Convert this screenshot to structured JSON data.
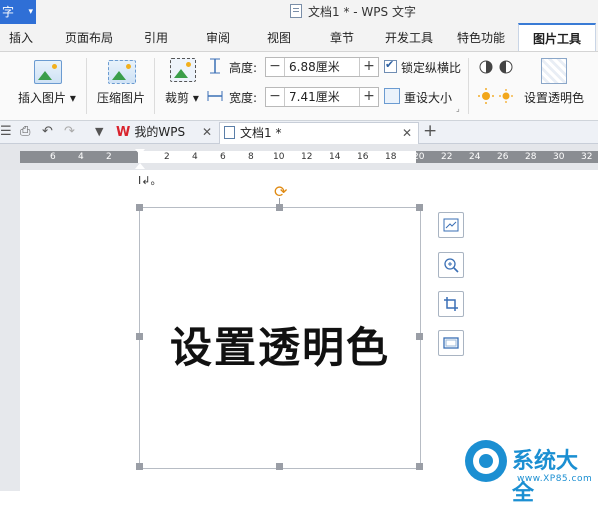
{
  "titlebar": {
    "app_label": "字",
    "doc_title": "文档1 * - WPS 文字"
  },
  "menu_tabs": [
    "插入",
    "页面布局",
    "引用",
    "审阅",
    "视图",
    "章节",
    "开发工具",
    "特色功能",
    "图片工具"
  ],
  "active_tab": "图片工具",
  "ribbon": {
    "insert_picture": "插入图片",
    "compress_picture": "压缩图片",
    "crop": "裁剪",
    "height_label": "高度:",
    "height_value": "6.88厘米",
    "width_label": "宽度:",
    "width_value": "7.41厘米",
    "lock_ratio": "锁定纵横比",
    "reset_size": "重设大小",
    "set_transparent": "设置透明色"
  },
  "doc_tabs": {
    "tab1": "我的WPS",
    "tab2": "文档1 *"
  },
  "ruler_ticks": [
    "6",
    "4",
    "2",
    "2",
    "4",
    "6",
    "8",
    "10",
    "12",
    "14",
    "16",
    "18",
    "20",
    "22",
    "24",
    "26",
    "28",
    "30",
    "32"
  ],
  "picture": {
    "text": "设置透明色"
  },
  "watermark": {
    "title": "系统大全",
    "url": "www.XP85.com"
  },
  "colors": {
    "accent": "#3a7bd5",
    "app_button": "#2f6fd6",
    "watermark": "#1b8fd2",
    "rotate_handle": "#e08a12"
  }
}
